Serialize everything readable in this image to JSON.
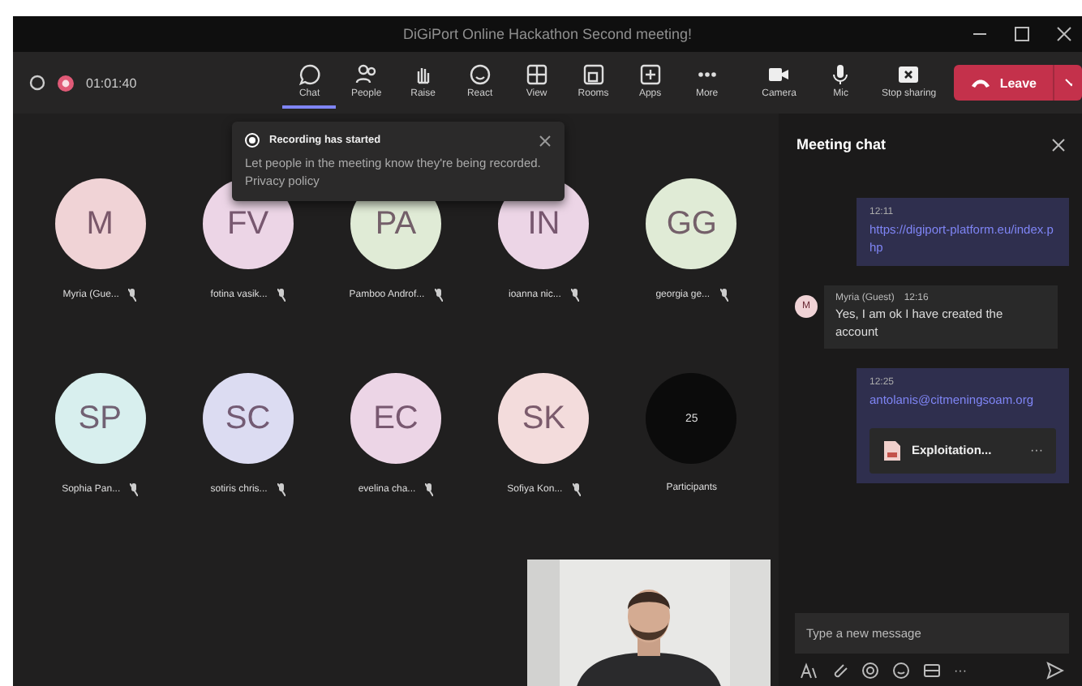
{
  "window": {
    "title": "DiGiPort Online Hackathon Second meeting!"
  },
  "toolbar": {
    "timer": "01:01:40",
    "items": [
      {
        "kind": "chat",
        "label": "Chat",
        "selected": true
      },
      {
        "kind": "people",
        "label": "People",
        "selected": false
      },
      {
        "kind": "raise",
        "label": "Raise",
        "selected": false
      },
      {
        "kind": "react",
        "label": "React",
        "selected": false
      },
      {
        "kind": "view",
        "label": "View",
        "selected": false
      },
      {
        "kind": "rooms",
        "label": "Rooms",
        "selected": false
      },
      {
        "kind": "apps",
        "label": "Apps",
        "selected": false
      },
      {
        "kind": "more",
        "label": "More",
        "selected": false
      }
    ],
    "devices": [
      {
        "kind": "camera",
        "label": "Camera"
      },
      {
        "kind": "mic",
        "label": "Mic"
      },
      {
        "kind": "share",
        "label": "Stop sharing"
      }
    ],
    "leave": "Leave"
  },
  "toast": {
    "title": "Recording has started",
    "text": "Let people in the meeting know they're being recorded. Privacy policy"
  },
  "participants": [
    {
      "kind": "avatar",
      "initials": "M",
      "name": "Myria (Gue...",
      "color": "#f0d3d6"
    },
    {
      "kind": "avatar",
      "initials": "FV",
      "name": "fotina vasik...",
      "color": "#ecd5e6"
    },
    {
      "kind": "avatar",
      "initials": "PA",
      "name": "Pamboo Androf...",
      "color": "#e0ebd6"
    },
    {
      "kind": "avatar",
      "initials": "IN",
      "name": "ioanna nic...",
      "color": "#ecd5e6"
    },
    {
      "kind": "avatar",
      "initials": "GG",
      "name": "georgia ge...",
      "color": "#e0ebd6"
    },
    {
      "kind": "avatar",
      "initials": "SP",
      "name": "Sophia Pan...",
      "color": "#d8efee"
    },
    {
      "kind": "avatar",
      "initials": "SC",
      "name": "sotiris chris...",
      "color": "#dcdcf2"
    },
    {
      "kind": "avatar",
      "initials": "EC",
      "name": "evelina cha...",
      "color": "#ecd5e6"
    },
    {
      "kind": "avatar",
      "initials": "SK",
      "name": "Sofiya Kon...",
      "color": "#f3dcdc"
    },
    {
      "kind": "count",
      "initials": "25",
      "name": "Participants"
    }
  ],
  "chat": {
    "title": "Meeting chat",
    "messages": [
      {
        "kind": "own",
        "time": "12:11",
        "link": "https://digiport-platform.eu/index.php"
      },
      {
        "kind": "other",
        "initial": "M",
        "author": "Myria (Guest)",
        "time": "12:16",
        "text": "Yes, I am ok I have created the account"
      },
      {
        "kind": "own",
        "time": "12:25",
        "link": "antolanis@citmeningsoam.org",
        "file": "Exploitation...",
        "file_more": "···"
      }
    ],
    "placeholder": "Type a new message",
    "more": "···"
  }
}
